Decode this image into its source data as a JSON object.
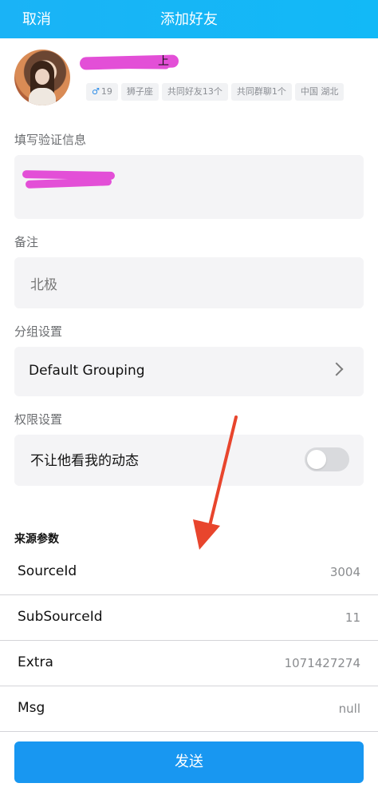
{
  "header": {
    "cancel_label": "取消",
    "title": "添加好友"
  },
  "profile": {
    "name_visible_tail": "上",
    "tags": [
      "19",
      "狮子座",
      "共同好友13个",
      "共同群聊1个",
      "中国 湖北"
    ]
  },
  "verify": {
    "label": "填写验证信息"
  },
  "remark": {
    "label": "备注",
    "value": "北极"
  },
  "group": {
    "label": "分组设置",
    "value": "Default Grouping"
  },
  "permission": {
    "label": "权限设置",
    "toggle_label": "不让他看我的动态",
    "enabled": false
  },
  "source": {
    "title": "来源参数",
    "rows": [
      {
        "key": "SourceId",
        "value": "3004"
      },
      {
        "key": "SubSourceId",
        "value": "11"
      },
      {
        "key": "Extra",
        "value": "1071427274"
      },
      {
        "key": "Msg",
        "value": "null"
      }
    ]
  },
  "send_label": "发送",
  "colors": {
    "accent": "#1897f1",
    "header": "#1ab3f6",
    "annotation_arrow": "#e8452d",
    "redaction": "#e34fd7"
  }
}
